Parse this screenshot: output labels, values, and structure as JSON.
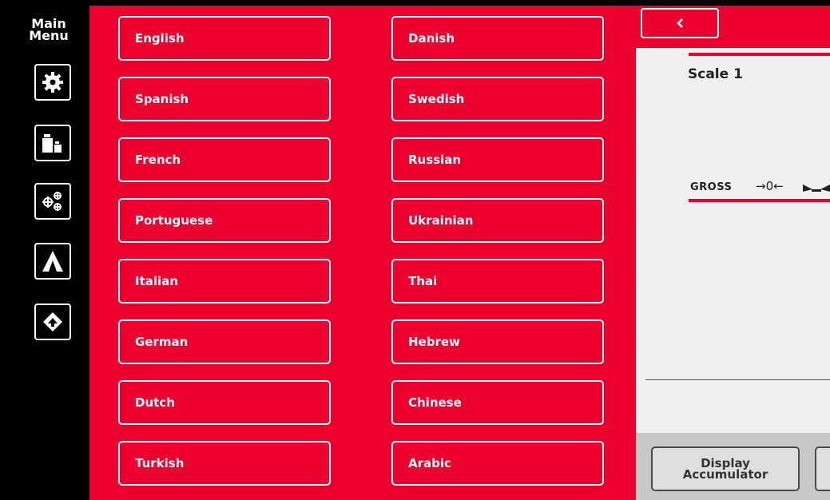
{
  "sidebar": {
    "title": "Main\nMenu",
    "buttons": [
      {
        "name": "settings",
        "icon": "gear-icon"
      },
      {
        "name": "weights",
        "icon": "weights-icon"
      },
      {
        "name": "calibration",
        "icon": "crosshair-icon"
      },
      {
        "name": "triangle",
        "icon": "triangle-icon"
      },
      {
        "name": "recycle",
        "icon": "recycle-arrow-icon"
      }
    ]
  },
  "languages": [
    [
      "English",
      "Danish"
    ],
    [
      "Spanish",
      "Swedish"
    ],
    [
      "French",
      "Russian"
    ],
    [
      "Portuguese",
      "Ukrainian"
    ],
    [
      "Italian",
      "Thai"
    ],
    [
      "German",
      "Hebrew"
    ],
    [
      "Dutch",
      "Chinese"
    ],
    [
      "Turkish",
      "Arabic"
    ]
  ],
  "back_icon": "chevron-left-icon",
  "scale": {
    "name": "Scale 1",
    "mode": "GROSS",
    "zero_indicator": "→0←",
    "stable_icon": "stable-icon"
  },
  "footer": {
    "display_accumulator": "Display\nAccumulator"
  },
  "colors": {
    "accent": "#ec0030",
    "panel": "#f1efef",
    "footer": "#c9c6c6",
    "sidebar": "#000000"
  }
}
